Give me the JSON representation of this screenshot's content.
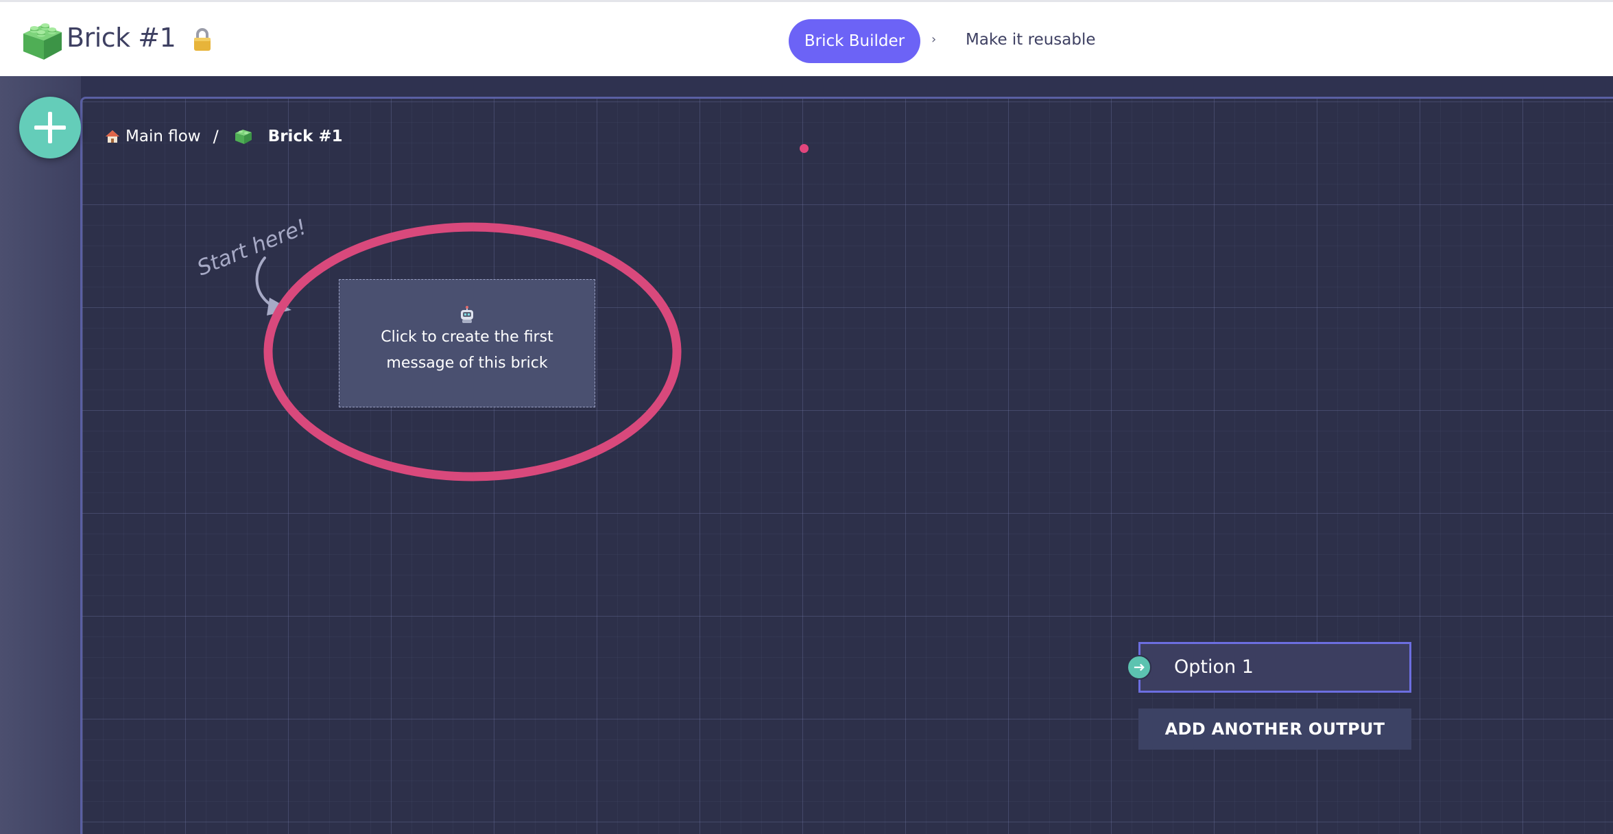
{
  "header": {
    "title": "Brick #1",
    "steps": [
      {
        "label": "Brick Builder",
        "active": true
      },
      {
        "label": "Make it reusable",
        "active": false
      }
    ],
    "step_separator": "›"
  },
  "breadcrumb": {
    "items": [
      {
        "label": "Main flow",
        "icon": "house-icon"
      },
      {
        "label": "Brick #1",
        "icon": "brick-icon"
      }
    ],
    "separator": "/"
  },
  "canvas": {
    "annotation": "Start here!",
    "first_message_card": {
      "icon": "robot-icon",
      "text": "Click to create the first message of this brick"
    },
    "outputs": [
      {
        "label": "Option 1"
      }
    ],
    "add_output_label": "ADD ANOTHER OUTPUT"
  },
  "colors": {
    "accent": "#6c63f6",
    "add_button": "#64cdb9",
    "highlight": "#d9497c",
    "canvas_bg": "#2d304a"
  }
}
